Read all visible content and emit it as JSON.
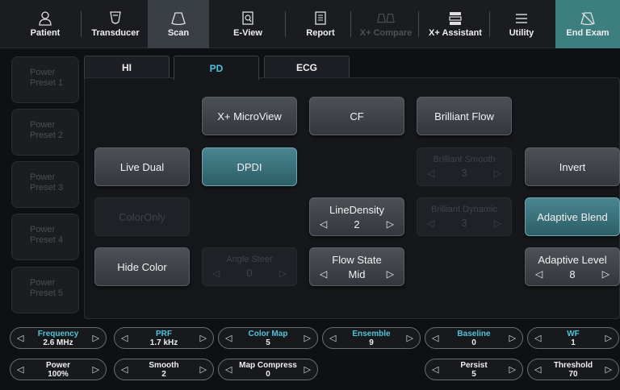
{
  "toolbar": {
    "patient": "Patient",
    "transducer": "Transducer",
    "scan": "Scan",
    "eview": "E-View",
    "report": "Report",
    "compare": "X+ Compare",
    "assistant": "X+ Assistant",
    "utility": "Utility",
    "end_exam": "End Exam"
  },
  "presets": [
    {
      "line1": "Power",
      "line2": "Preset 1"
    },
    {
      "line1": "Power",
      "line2": "Preset 2"
    },
    {
      "line1": "Power",
      "line2": "Preset 3"
    },
    {
      "line1": "Power",
      "line2": "Preset 4"
    },
    {
      "line1": "Power",
      "line2": "Preset 5"
    }
  ],
  "tabs": [
    "HI",
    "PD",
    "ECG"
  ],
  "buttons": {
    "microview": "X+ MicroView",
    "cf": "CF",
    "brilliant_flow": "Brilliant Flow",
    "live_dual": "Live Dual",
    "dpdi": "DPDI",
    "invert": "Invert",
    "color_only": "ColorOnly",
    "adaptive_blend": "Adaptive Blend",
    "hide_color": "Hide Color",
    "brilliant_smooth": {
      "label": "Brilliant Smooth",
      "value": "3"
    },
    "brilliant_dynamic": {
      "label": "Brilliant Dynamic",
      "value": "3"
    },
    "line_density": {
      "label": "LineDensity",
      "value": "2"
    },
    "angle_steer": {
      "label": "Angle Steer",
      "value": "0"
    },
    "flow_state": {
      "label": "Flow State",
      "value": "Mid"
    },
    "adaptive_level": {
      "label": "Adaptive Level",
      "value": "8"
    }
  },
  "params_row1": [
    {
      "name": "Frequency",
      "value": "2.6 MHz"
    },
    {
      "name": "PRF",
      "value": "1.7 kHz"
    },
    {
      "name": "Color Map",
      "value": "5"
    },
    {
      "name": "Ensemble",
      "value": "9"
    },
    {
      "name": "Baseline",
      "value": "0"
    },
    {
      "name": "WF",
      "value": "1"
    }
  ],
  "params_row2": [
    {
      "name": "Power",
      "value": "100%"
    },
    {
      "name": "Smooth",
      "value": "2"
    },
    {
      "name": "Map Compress",
      "value": "0"
    },
    {
      "name": "Persist",
      "value": "5"
    },
    {
      "name": "Threshold",
      "value": "70"
    }
  ],
  "colors": {
    "accent": "#4fc3d9",
    "end_exam": "#3d7e80",
    "teal_button": "#2c5e66"
  }
}
